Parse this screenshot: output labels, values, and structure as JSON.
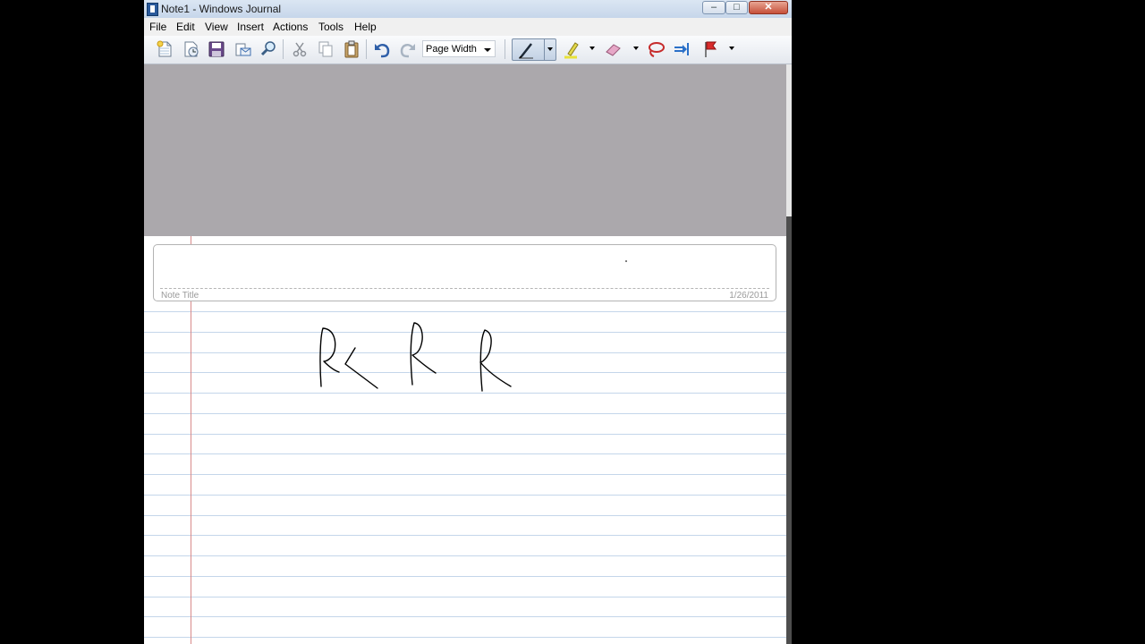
{
  "window": {
    "title": "Note1 - Windows Journal"
  },
  "menu": [
    "File",
    "Edit",
    "View",
    "Insert",
    "Actions",
    "Tools",
    "Help"
  ],
  "toolbar": {
    "zoom_value": "Page Width"
  },
  "note": {
    "title_label": "Note Title",
    "date": "1/26/2011"
  },
  "icons": {
    "toolbar": [
      "new-note-icon",
      "new-note-from-template-icon",
      "save-icon",
      "email-icon",
      "find-icon",
      "cut-icon",
      "copy-icon",
      "paste-icon",
      "undo-icon",
      "redo-icon",
      "pen-icon",
      "highlighter-icon",
      "eraser-icon",
      "lasso-select-icon",
      "insert-space-icon",
      "flag-icon"
    ],
    "window_controls": [
      "minimize-icon",
      "restore-icon",
      "close-icon"
    ]
  },
  "ink": {
    "content": "handwritten strokes: R< R R"
  },
  "colors": {
    "ruled_line": "#c4d6ea",
    "margin_line": "#d88a8a",
    "gray_area": "#aba8ac",
    "pen_ink": "#000000"
  }
}
